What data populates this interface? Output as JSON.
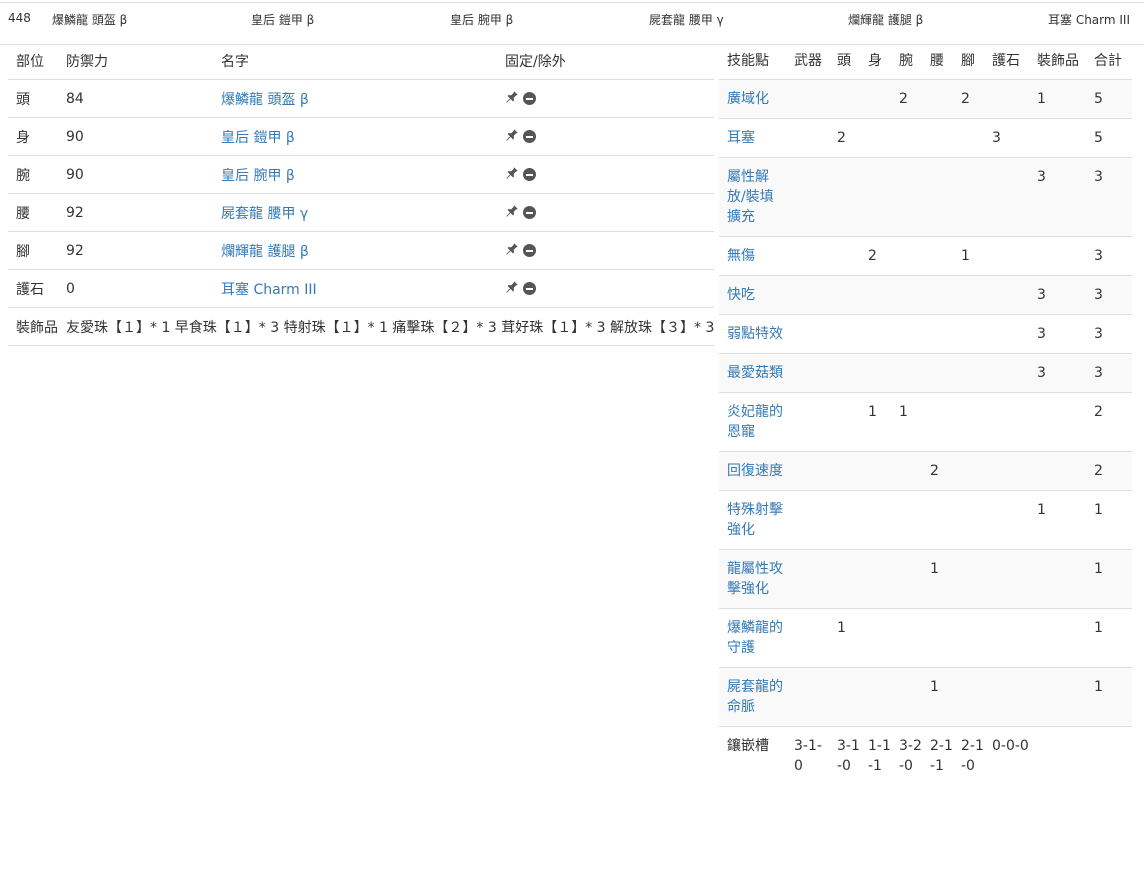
{
  "summary": {
    "defense": "448",
    "head": "爆鱗龍 頭盔 β",
    "body": "皇后 鎧甲 β",
    "arm": "皇后 腕甲 β",
    "waist": "屍套龍 腰甲 γ",
    "leg": "爛輝龍 護腿 β",
    "charm": "耳塞 Charm III"
  },
  "equipment": {
    "headers": [
      "部位",
      "防禦力",
      "名字",
      "固定/除外"
    ],
    "rows": [
      {
        "part": "頭",
        "defense": "84",
        "name": "爆鱗龍 頭盔 β"
      },
      {
        "part": "身",
        "defense": "90",
        "name": "皇后 鎧甲 β"
      },
      {
        "part": "腕",
        "defense": "90",
        "name": "皇后 腕甲 β"
      },
      {
        "part": "腰",
        "defense": "92",
        "name": "屍套龍 腰甲 γ"
      },
      {
        "part": "腳",
        "defense": "92",
        "name": "爛輝龍 護腿 β"
      },
      {
        "part": "護石",
        "defense": "0",
        "name": "耳塞 Charm III"
      }
    ],
    "decorations_label": "裝飾品",
    "decorations": "友愛珠【１】* 1 早食珠【１】* 3 特射珠【１】* 1 痛擊珠【２】* 3 茸好珠【１】* 3 解放珠【３】* 3"
  },
  "skills": {
    "headers": [
      "技能點",
      "武器",
      "頭",
      "身",
      "腕",
      "腰",
      "腳",
      "護石",
      "裝飾品",
      "合計"
    ],
    "rows": [
      {
        "name": "廣域化",
        "cells": [
          "",
          "",
          "",
          "2",
          "",
          "2",
          "",
          "1",
          "5"
        ]
      },
      {
        "name": "耳塞",
        "cells": [
          "",
          "2",
          "",
          "",
          "",
          "",
          "3",
          "",
          "5"
        ]
      },
      {
        "name": "屬性解放/裝填擴充",
        "cells": [
          "",
          "",
          "",
          "",
          "",
          "",
          "",
          "3",
          "3"
        ]
      },
      {
        "name": "無傷",
        "cells": [
          "",
          "",
          "2",
          "",
          "",
          "1",
          "",
          "",
          "3"
        ]
      },
      {
        "name": "快吃",
        "cells": [
          "",
          "",
          "",
          "",
          "",
          "",
          "",
          "3",
          "3"
        ]
      },
      {
        "name": "弱點特效",
        "cells": [
          "",
          "",
          "",
          "",
          "",
          "",
          "",
          "3",
          "3"
        ]
      },
      {
        "name": "最愛菇類",
        "cells": [
          "",
          "",
          "",
          "",
          "",
          "",
          "",
          "3",
          "3"
        ]
      },
      {
        "name": "炎妃龍的恩寵",
        "cells": [
          "",
          "",
          "1",
          "1",
          "",
          "",
          "",
          "",
          "2"
        ]
      },
      {
        "name": "回復速度",
        "cells": [
          "",
          "",
          "",
          "",
          "2",
          "",
          "",
          "",
          "2"
        ]
      },
      {
        "name": "特殊射擊強化",
        "cells": [
          "",
          "",
          "",
          "",
          "",
          "",
          "",
          "1",
          "1"
        ]
      },
      {
        "name": "龍屬性攻擊強化",
        "cells": [
          "",
          "",
          "",
          "",
          "1",
          "",
          "",
          "",
          "1"
        ]
      },
      {
        "name": "爆鱗龍的守護",
        "cells": [
          "",
          "1",
          "",
          "",
          "",
          "",
          "",
          "",
          "1"
        ]
      },
      {
        "name": "屍套龍的命脈",
        "cells": [
          "",
          "",
          "",
          "",
          "1",
          "",
          "",
          "",
          "1"
        ]
      }
    ],
    "slots_label": "鑲嵌槽",
    "slots": [
      "3-1-0",
      "3-1-0",
      "1-1-1",
      "3-2-0",
      "2-1-1",
      "2-1-0",
      "0-0-0",
      "",
      ""
    ]
  }
}
